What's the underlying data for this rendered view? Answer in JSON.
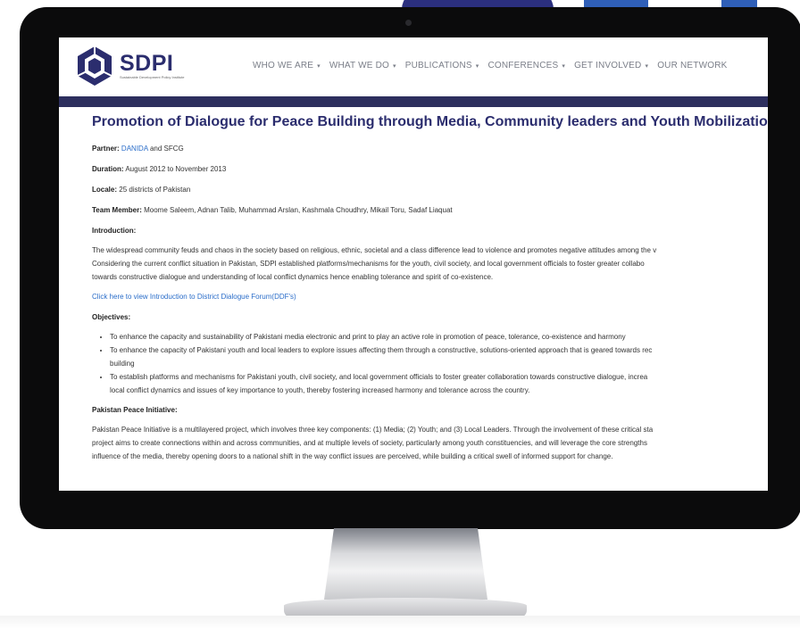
{
  "site": {
    "logo_text": "SDPI",
    "logo_tagline": "Sustainable Development Policy Institute"
  },
  "nav": [
    {
      "label": "WHO WE ARE"
    },
    {
      "label": "WHAT WE DO"
    },
    {
      "label": "PUBLICATIONS"
    },
    {
      "label": "CONFERENCES"
    },
    {
      "label": "GET INVOLVED"
    },
    {
      "label": "OUR NETWORK"
    }
  ],
  "page": {
    "title": "Promotion of Dialogue for Peace Building through Media, Community leaders and Youth Mobilization",
    "partner_label": "Partner:",
    "partner_link": "DANIDA",
    "partner_rest": "and SFCG",
    "duration_label": "Duration:",
    "duration_value": "August 2012 to November 2013",
    "locale_label": "Locale:",
    "locale_value": "25 districts of Pakistan",
    "team_label": "Team Member:",
    "team_value": "Moome Saleem, Adnan Talib, Muhammad Arslan, Kashmala Choudhry, Mikail Toru, Sadaf Liaquat",
    "intro_heading": "Introduction:",
    "intro_lines": [
      "The widespread community feuds and chaos in the society based on religious, ethnic, societal and a class difference lead to violence and promotes negative attitudes among the v",
      "Considering the current conflict situation in Pakistan, SDPI established platforms/mechanisms for the youth, civil society, and local government officials to foster greater collabo",
      "towards constructive dialogue and understanding of local conflict dynamics hence enabling tolerance and spirit of co-existence."
    ],
    "ddf_link": "Click here to view Introduction to District Dialogue Forum(DDF's)",
    "objectives_heading": "Objectives:",
    "objectives": [
      "To enhance the capacity and sustainability of Pakistani media electronic and print to play an active role in promotion of peace, tolerance, co-existence and harmony",
      "To enhance the capacity of Pakistani youth and local leaders to explore issues affecting them through a constructive, solutions-oriented approach that is geared towards rec",
      "building",
      "To establish platforms and mechanisms for Pakistani youth, civil society, and local government officials to foster greater collaboration towards constructive dialogue, increa",
      "local conflict dynamics and issues of key importance to youth, thereby fostering increased harmony and tolerance across the country."
    ],
    "ppi_heading": "Pakistan Peace Initiative:",
    "ppi_lines": [
      "Pakistan Peace Initiative is a multilayered project, which involves three key components: (1) Media; (2) Youth; and (3) Local Leaders. Through the involvement of these critical sta",
      "project aims to create connections within and across communities, and at multiple levels of society, particularly among youth constituencies, and will leverage the core strengths",
      "influence of the media, thereby opening doors to a national shift in the way conflict issues are perceived, while building a critical swell of informed support for change."
    ]
  }
}
